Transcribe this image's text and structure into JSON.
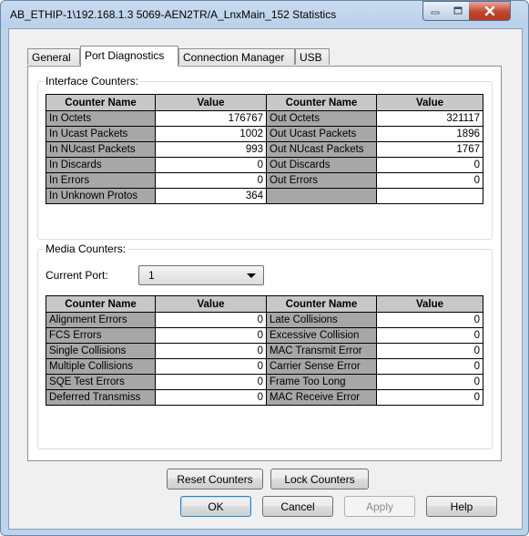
{
  "window": {
    "title": "AB_ETHIP-1\\192.168.1.3 5069-AEN2TR/A_LnxMain_152 Statistics",
    "controls": {
      "minimize_icon": "minimize-icon",
      "maximize_icon": "maximize-icon",
      "close_icon": "close-icon"
    }
  },
  "tabs": [
    {
      "label": "General",
      "active": false
    },
    {
      "label": "Port Diagnostics",
      "active": true
    },
    {
      "label": "Connection Manager",
      "active": false
    },
    {
      "label": "USB",
      "active": false
    }
  ],
  "interface_counters": {
    "group_label": "Interface Counters:",
    "headers": [
      "Counter Name",
      "Value",
      "Counter Name",
      "Value"
    ],
    "rows": [
      {
        "left_name": "In Octets",
        "left_value": "176767",
        "right_name": "Out Octets",
        "right_value": "321117"
      },
      {
        "left_name": "In Ucast Packets",
        "left_value": "1002",
        "right_name": "Out Ucast Packets",
        "right_value": "1896"
      },
      {
        "left_name": "In NUcast Packets",
        "left_value": "993",
        "right_name": "Out NUcast Packets",
        "right_value": "1767"
      },
      {
        "left_name": "In Discards",
        "left_value": "0",
        "right_name": "Out Discards",
        "right_value": "0"
      },
      {
        "left_name": "In Errors",
        "left_value": "0",
        "right_name": "Out Errors",
        "right_value": "0"
      },
      {
        "left_name": "In Unknown Protos",
        "left_value": "364",
        "right_name": "",
        "right_value": ""
      }
    ]
  },
  "media_counters": {
    "group_label": "Media Counters:",
    "current_port_label": "Current Port:",
    "current_port_value": "1",
    "headers": [
      "Counter Name",
      "Value",
      "Counter Name",
      "Value"
    ],
    "rows": [
      {
        "left_name": "Alignment Errors",
        "left_value": "0",
        "right_name": "Late Collisions",
        "right_value": "0"
      },
      {
        "left_name": "FCS Errors",
        "left_value": "0",
        "right_name": "Excessive Collision",
        "right_value": "0"
      },
      {
        "left_name": "Single Collisions",
        "left_value": "0",
        "right_name": "MAC Transmit Error",
        "right_value": "0"
      },
      {
        "left_name": "Multiple Collisions",
        "left_value": "0",
        "right_name": "Carrier Sense Error",
        "right_value": "0"
      },
      {
        "left_name": "SQE Test Errors",
        "left_value": "0",
        "right_name": "Frame Too Long",
        "right_value": "0"
      },
      {
        "left_name": "Deferred Transmiss",
        "left_value": "0",
        "right_name": "MAC Receive Error",
        "right_value": "0"
      }
    ]
  },
  "panel_buttons": {
    "reset_label": "Reset Counters",
    "lock_label": "Lock Counters"
  },
  "dialog_buttons": {
    "ok_label": "OK",
    "cancel_label": "Cancel",
    "apply_label": "Apply",
    "help_label": "Help"
  }
}
